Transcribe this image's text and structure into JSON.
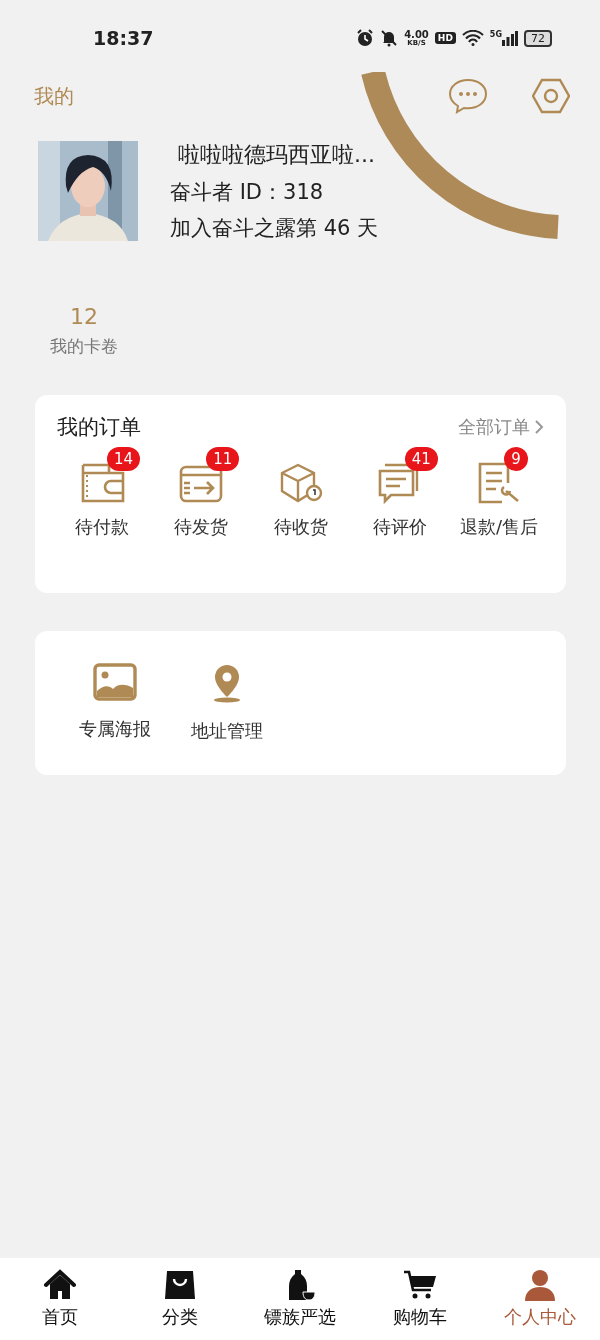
{
  "status_bar": {
    "time": "18:37",
    "speed": "4.00",
    "speed_unit": "KB/S",
    "hd": "HD",
    "network": "5G",
    "battery": "72"
  },
  "header": {
    "title": "我的"
  },
  "profile": {
    "name": "啦啦啦德玛西亚啦...",
    "id_line": "奋斗者  ID：318",
    "days_line": "加入奋斗之露第  46 天"
  },
  "stats": [
    {
      "value": "12",
      "label": "我的卡卷"
    }
  ],
  "orders": {
    "title": "我的订单",
    "all_link": "全部订单",
    "items": [
      {
        "kind": "wallet",
        "label": "待付款",
        "badge": "14"
      },
      {
        "kind": "ship",
        "label": "待发货",
        "badge": "11"
      },
      {
        "kind": "box",
        "label": "待收货"
      },
      {
        "kind": "review",
        "label": "待评价",
        "badge": "41"
      },
      {
        "kind": "refund",
        "label": "退款/售后",
        "badge": "9"
      }
    ]
  },
  "tools": [
    {
      "kind": "poster",
      "label": "专属海报"
    },
    {
      "kind": "address",
      "label": "地址管理"
    }
  ],
  "tabs": [
    {
      "kind": "home",
      "label": "首页",
      "selected": false
    },
    {
      "kind": "category",
      "label": "分类",
      "selected": false
    },
    {
      "kind": "bottle",
      "label": "镖族严选",
      "selected": false
    },
    {
      "kind": "cart",
      "label": "购物车",
      "selected": false
    },
    {
      "kind": "person",
      "label": "个人中心",
      "selected": true
    }
  ]
}
